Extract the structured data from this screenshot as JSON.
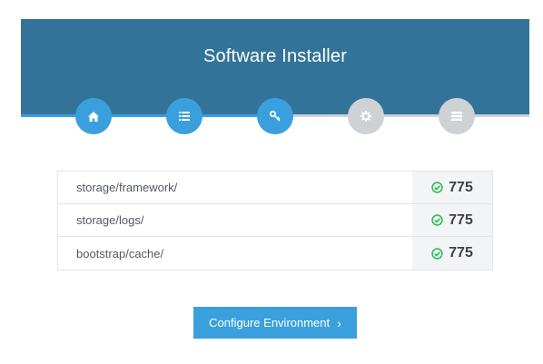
{
  "header": {
    "title": "Software Installer"
  },
  "steps": [
    {
      "name": "home",
      "icon": "home-icon",
      "state": "done"
    },
    {
      "name": "requirements",
      "icon": "list-icon",
      "state": "done"
    },
    {
      "name": "permissions",
      "icon": "key-icon",
      "state": "current"
    },
    {
      "name": "environment",
      "icon": "gear-icon",
      "state": "todo"
    },
    {
      "name": "final",
      "icon": "server-icon",
      "state": "todo"
    }
  ],
  "progress": {
    "completed_fraction": 0.5
  },
  "permissions": [
    {
      "path": "storage/framework/",
      "status_icon": "check-circle-icon",
      "value": "775"
    },
    {
      "path": "storage/logs/",
      "status_icon": "check-circle-icon",
      "value": "775"
    },
    {
      "path": "bootstrap/cache/",
      "status_icon": "check-circle-icon",
      "value": "775"
    }
  ],
  "actions": {
    "next_label": "Configure Environment",
    "next_icon": "chevron-right-icon"
  },
  "colors": {
    "header_bg": "#337399",
    "accent": "#3aa0dd",
    "inactive_step": "#cfd2d5",
    "success": "#2ebd5a"
  }
}
